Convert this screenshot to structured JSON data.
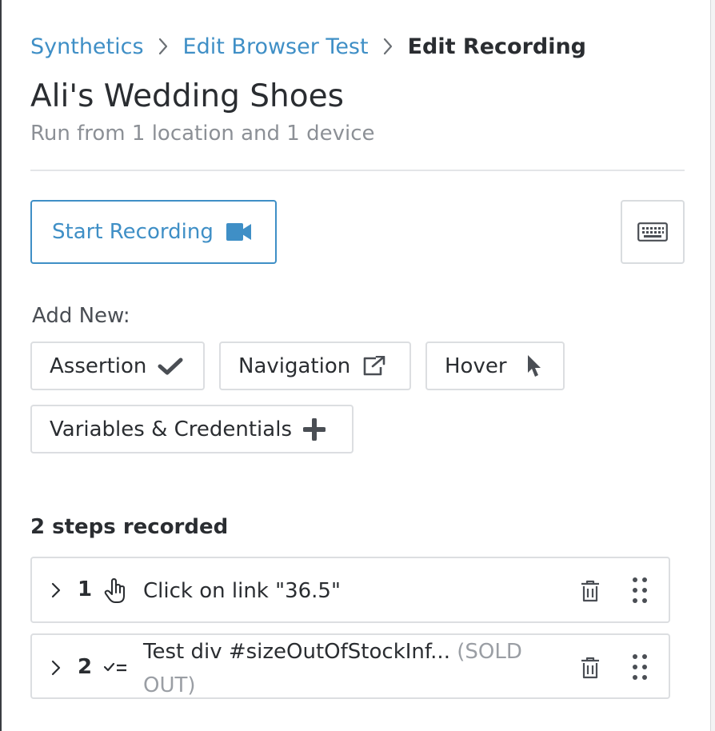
{
  "breadcrumb": {
    "items": [
      "Synthetics",
      "Edit Browser Test"
    ],
    "current": "Edit Recording"
  },
  "test": {
    "title": "Ali's Wedding Shoes",
    "subtitle": "Run from 1 location and 1 device"
  },
  "toolbar": {
    "start_recording_label": "Start Recording",
    "start_recording_icon": "video-camera-icon",
    "keyboard_icon": "keyboard-icon"
  },
  "add_new": {
    "label": "Add New:",
    "items": [
      {
        "label": "Assertion",
        "icon": "checkmark-icon"
      },
      {
        "label": "Navigation",
        "icon": "external-link-icon"
      },
      {
        "label": "Hover",
        "icon": "cursor-arrow-icon"
      },
      {
        "label": "Variables & Credentials",
        "icon": "plus-icon"
      }
    ]
  },
  "steps": {
    "count_label": "2 steps recorded",
    "items": [
      {
        "number": "1",
        "icon": "hand-pointer-icon",
        "text": "Click on link \"36.5\"",
        "muted": ""
      },
      {
        "number": "2",
        "icon": "assertion-equals-icon",
        "text": "Test div #sizeOutOfStockInf...",
        "muted": " (SOLD OUT)"
      }
    ]
  },
  "colors": {
    "accent": "#3f8fc6",
    "text": "#2a2d31",
    "muted": "#8c9096",
    "border": "#dcdee1"
  }
}
